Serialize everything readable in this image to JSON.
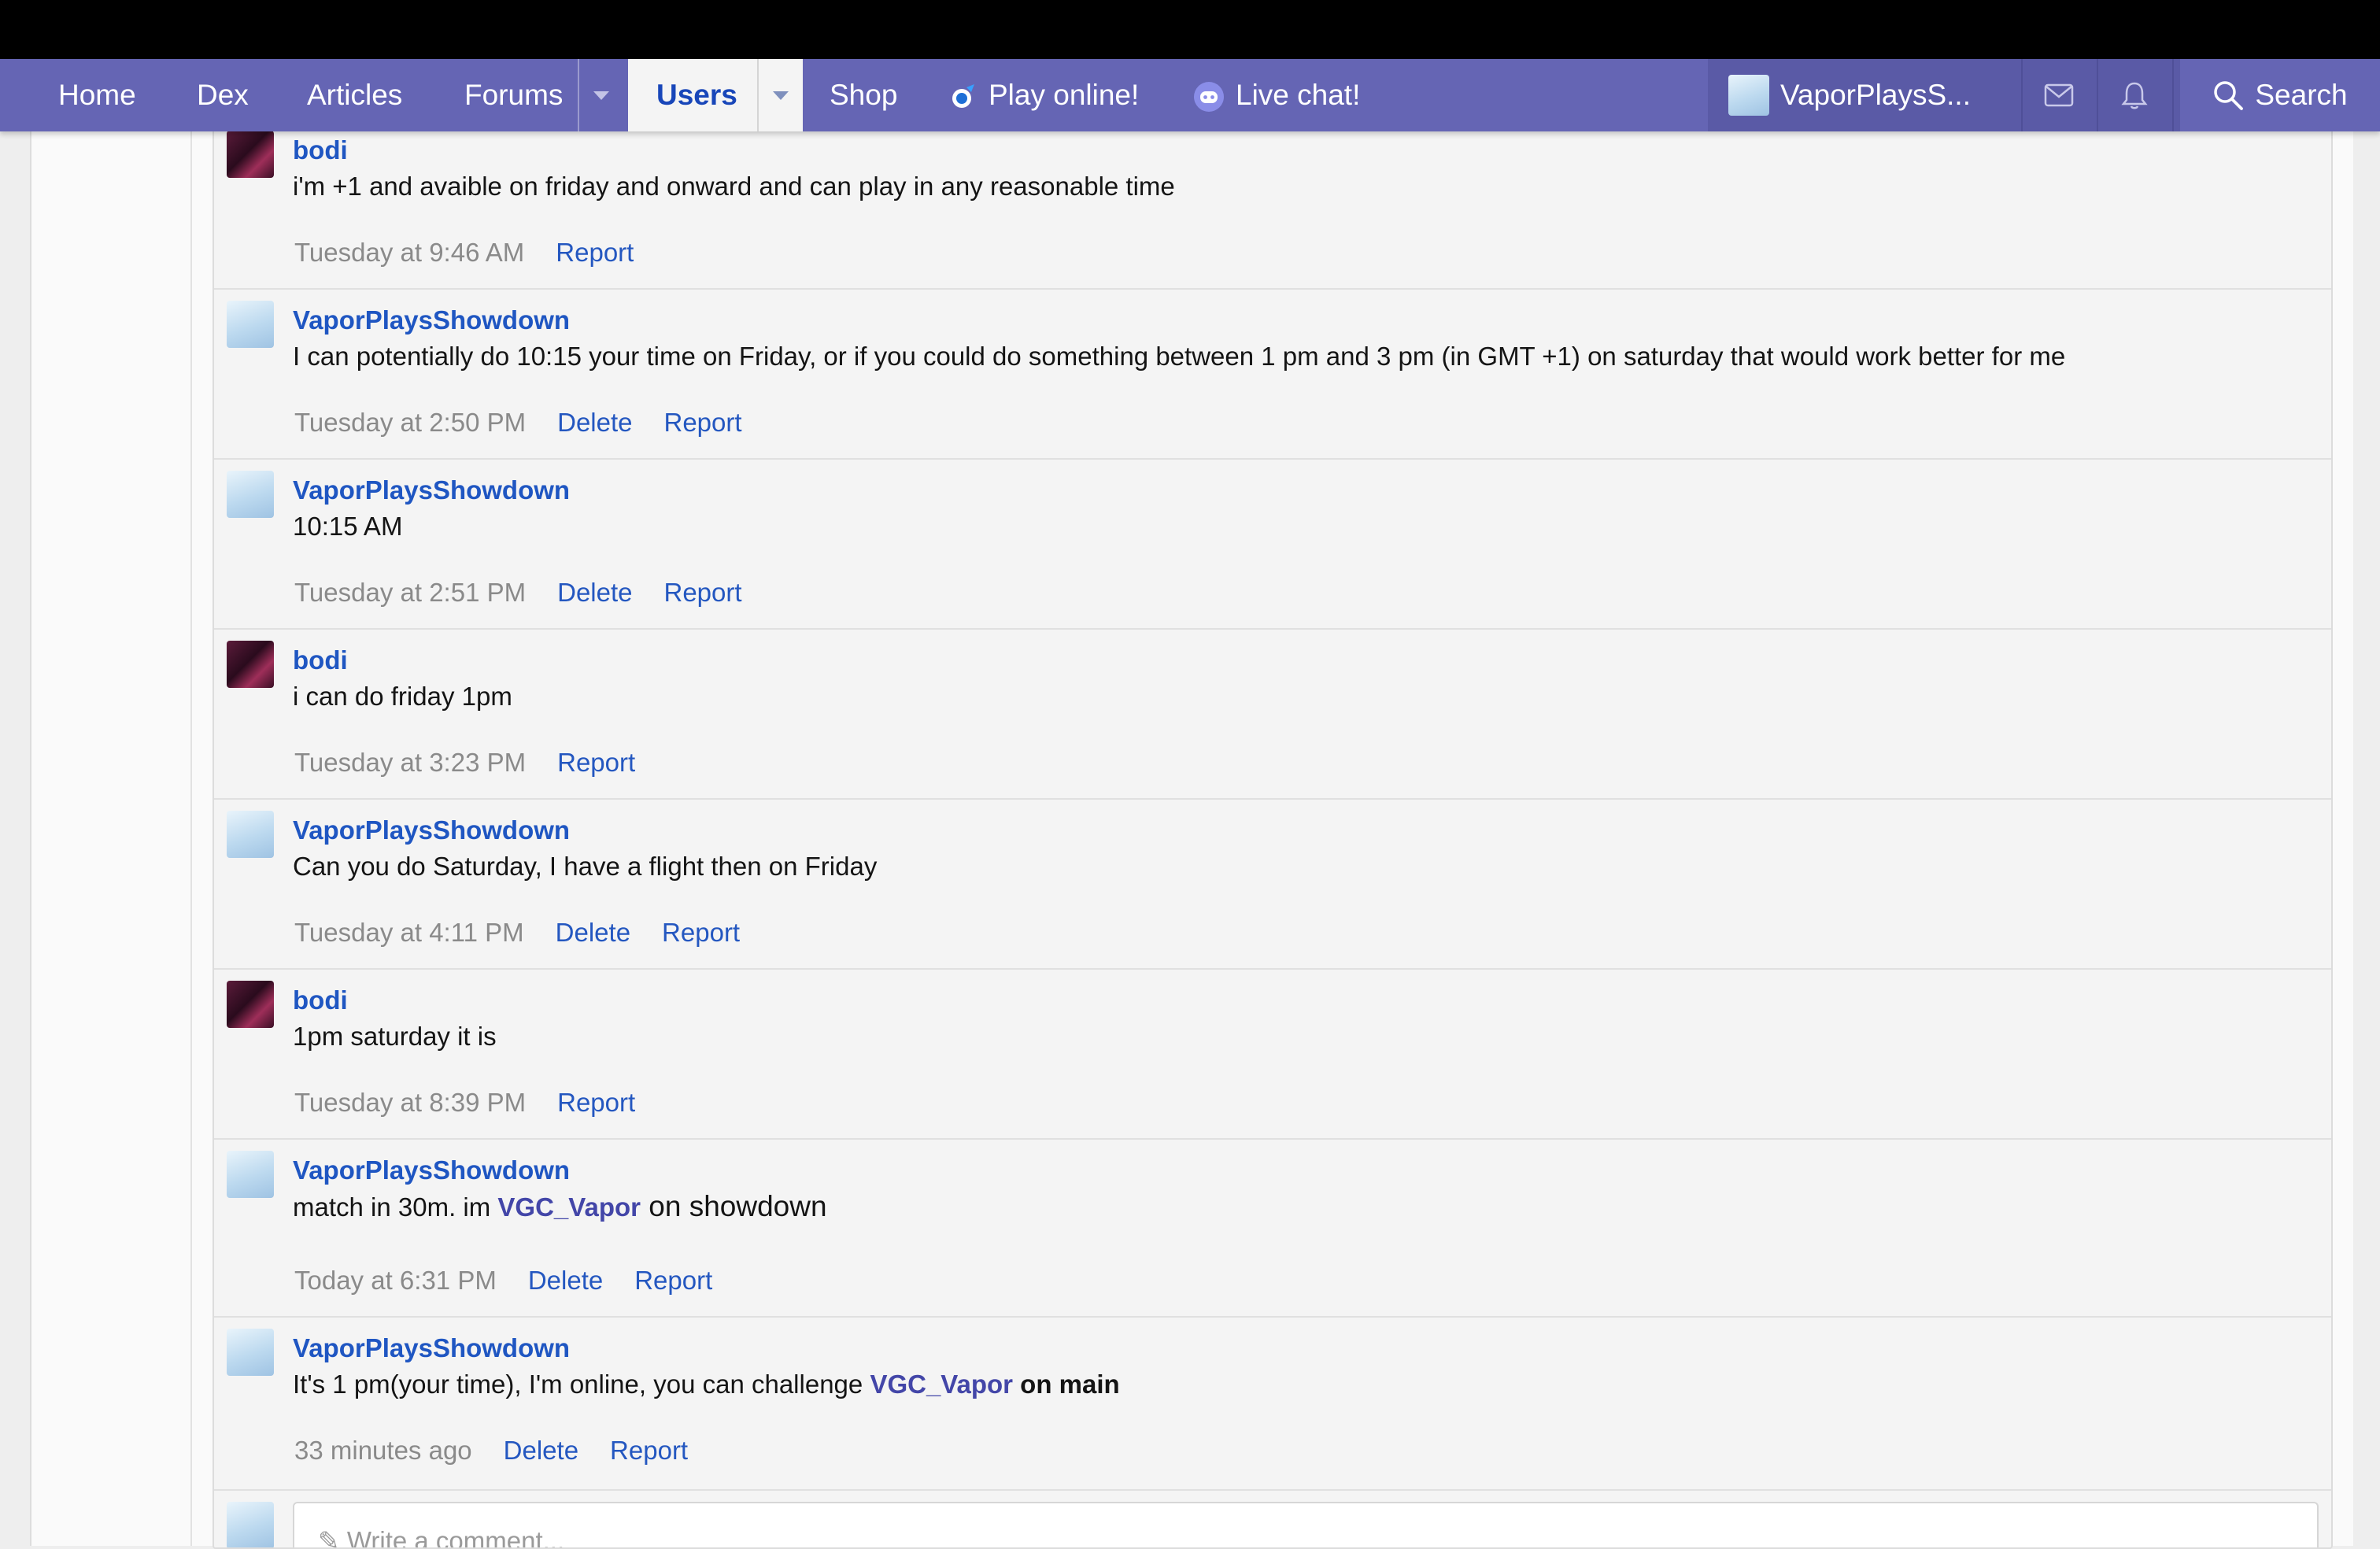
{
  "nav": {
    "items": [
      {
        "label": "Home"
      },
      {
        "label": "Dex"
      },
      {
        "label": "Articles"
      },
      {
        "label": "Forums"
      },
      {
        "label": "Users"
      },
      {
        "label": "Shop"
      },
      {
        "label": "Play online!"
      },
      {
        "label": "Live chat!"
      }
    ],
    "account_name": "VaporPlaysS...",
    "search_label": "Search",
    "accent_color": "#6565b4",
    "icons": [
      "showdown-icon",
      "discord-icon",
      "mail-icon",
      "bell-icon",
      "search-icon",
      "chevron-down-icon"
    ]
  },
  "comments": [
    {
      "author": "bodi",
      "text": "i'm +1 and avaible on friday and onward and can play in any reasonable time",
      "time": "Tuesday at 9:46 AM",
      "actions": [
        "Report"
      ]
    },
    {
      "author": "VaporPlaysShowdown",
      "text": "I can potentially do 10:15 your time on Friday, or if you could do something between 1 pm and 3 pm (in GMT +1) on saturday that would work better for me",
      "time": "Tuesday at 2:50 PM",
      "actions": [
        "Delete",
        "Report"
      ]
    },
    {
      "author": "VaporPlaysShowdown",
      "text": "10:15 AM",
      "time": "Tuesday at 2:51 PM",
      "actions": [
        "Delete",
        "Report"
      ]
    },
    {
      "author": "bodi",
      "text": "i can do friday 1pm",
      "time": "Tuesday at 3:23 PM",
      "actions": [
        "Report"
      ]
    },
    {
      "author": "VaporPlaysShowdown",
      "text": "Can you do Saturday, I have a flight then on Friday",
      "time": "Tuesday at 4:11 PM",
      "actions": [
        "Delete",
        "Report"
      ]
    },
    {
      "author": "bodi",
      "text": "1pm saturday it is",
      "time": "Tuesday at 8:39 PM",
      "actions": [
        "Report"
      ]
    },
    {
      "author": "VaporPlaysShowdown",
      "text_pre": "match in 30m. im ",
      "mention": "VGC_Vapor",
      "text_post": " on showdown",
      "time": "Today at 6:31 PM",
      "actions": [
        "Delete",
        "Report"
      ]
    },
    {
      "author": "VaporPlaysShowdown",
      "text_pre": "It's 1 pm(your time), I'm online, you can challenge ",
      "mention": "VGC_Vapor",
      "text_post": " on main",
      "time": "33 minutes ago",
      "actions": [
        "Delete",
        "Report"
      ]
    }
  ],
  "composer": {
    "placeholder": "Write a comment..."
  }
}
